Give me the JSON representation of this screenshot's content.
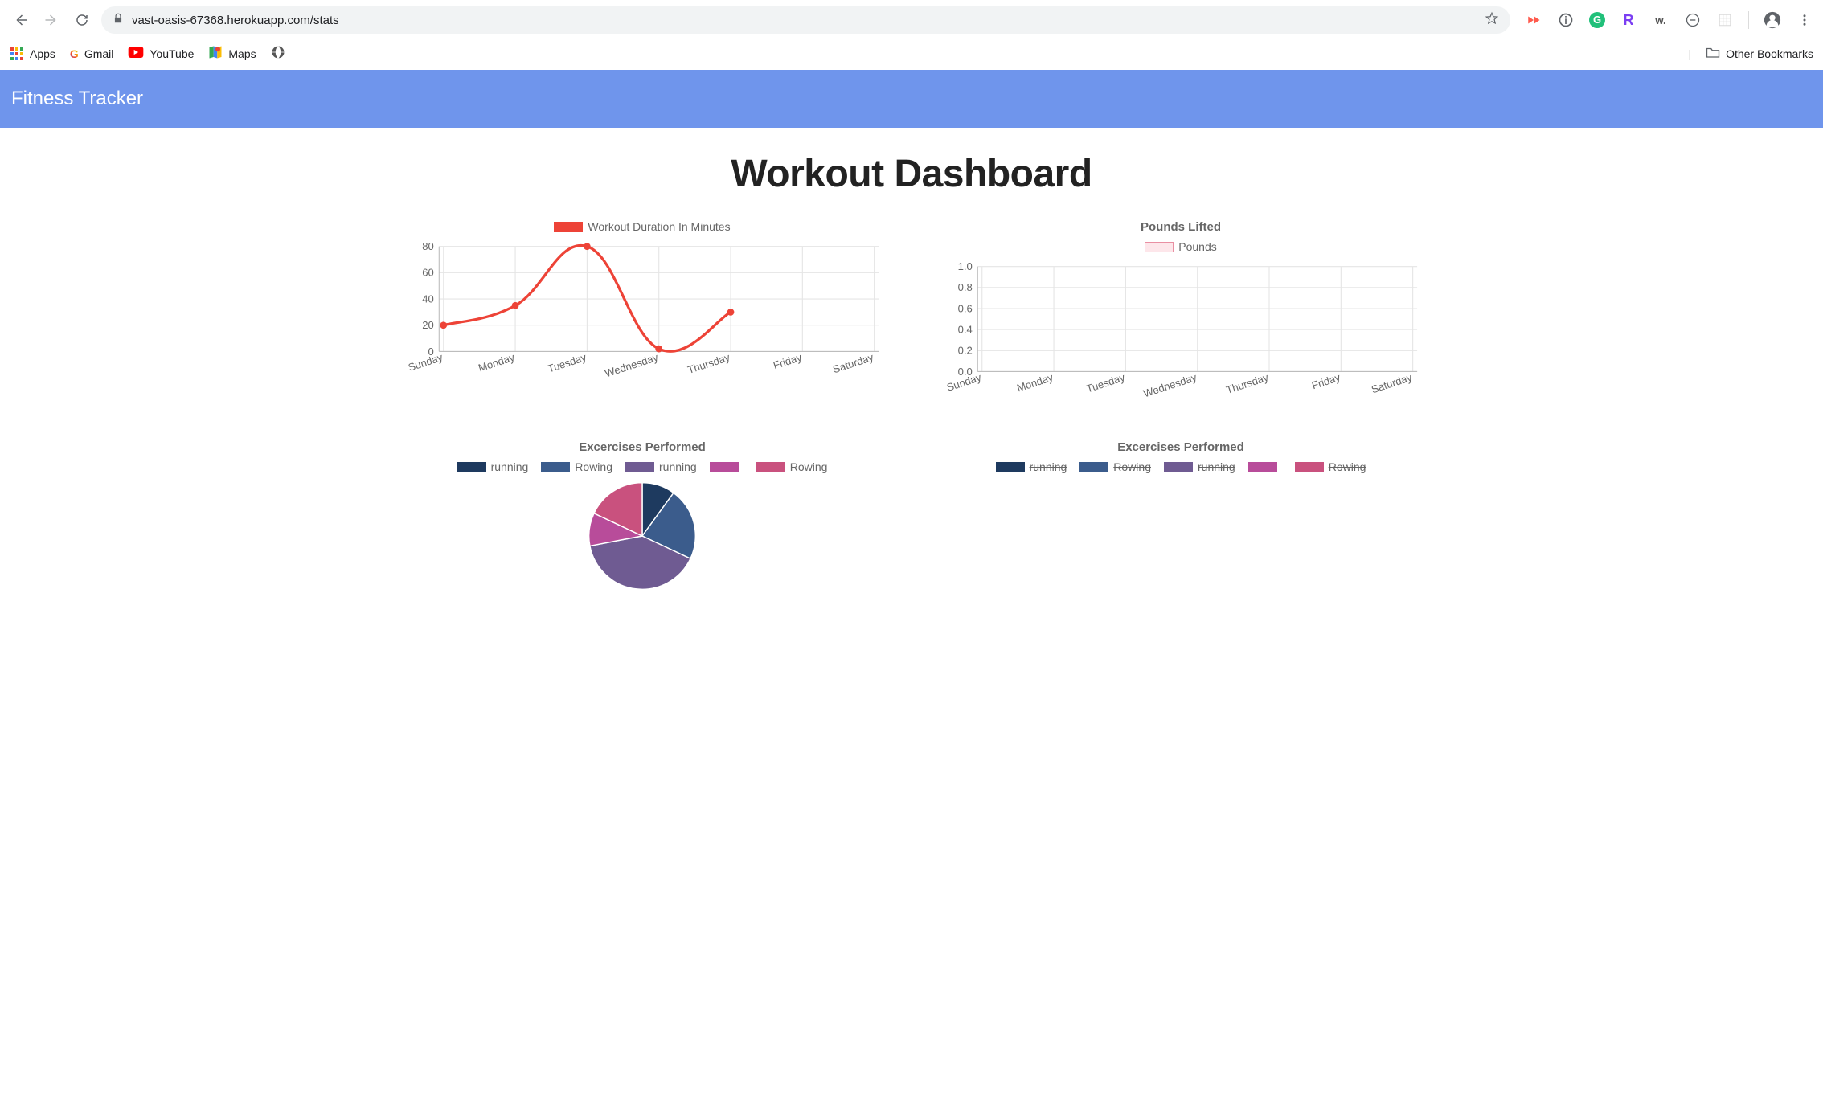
{
  "browser": {
    "url": "vast-oasis-67368.herokuapp.com/stats",
    "bookmarks": {
      "apps": "Apps",
      "gmail": "Gmail",
      "youtube": "YouTube",
      "maps": "Maps",
      "other": "Other Bookmarks"
    }
  },
  "header": {
    "title": "Fitness Tracker"
  },
  "page": {
    "title": "Workout Dashboard"
  },
  "colors": {
    "red": "#ed4337",
    "pinkFill": "#fde6ea",
    "pinkStroke": "#e98fa2",
    "navy": "#1e3a5f",
    "steel": "#3b5c8c",
    "purple": "#6f5b92",
    "magenta": "#b84c9a",
    "rose": "#c9517e"
  },
  "chart_data": [
    {
      "type": "line",
      "title": "",
      "legend": "Workout Duration In Minutes",
      "categories": [
        "Sunday",
        "Monday",
        "Tuesday",
        "Wednesday",
        "Thursday",
        "Friday",
        "Saturday"
      ],
      "values": [
        20,
        35,
        80,
        2,
        30,
        null,
        null
      ],
      "ylim": [
        0,
        80
      ],
      "ystep": 20,
      "color": "#ed4337"
    },
    {
      "type": "bar",
      "title": "Pounds Lifted",
      "legend": "Pounds",
      "categories": [
        "Sunday",
        "Monday",
        "Tuesday",
        "Wednesday",
        "Thursday",
        "Friday",
        "Saturday"
      ],
      "values": [
        null,
        null,
        null,
        null,
        null,
        null,
        null
      ],
      "ylim": [
        0,
        1.0
      ],
      "ystep": 0.2,
      "fill": "#fde6ea",
      "stroke": "#e98fa2"
    },
    {
      "type": "pie",
      "title": "Excercises Performed",
      "legend_items": [
        {
          "name": "running",
          "color": "#1e3a5f"
        },
        {
          "name": "Rowing",
          "color": "#3b5c8c"
        },
        {
          "name": "running",
          "color": "#6f5b92"
        },
        {
          "name": "",
          "color": "#b84c9a"
        },
        {
          "name": "Rowing",
          "color": "#c9517e"
        }
      ],
      "slices": [
        {
          "name": "running",
          "value": 10,
          "color": "#1e3a5f"
        },
        {
          "name": "Rowing",
          "value": 22,
          "color": "#3b5c8c"
        },
        {
          "name": "running",
          "value": 40,
          "color": "#6f5b92"
        },
        {
          "name": "",
          "value": 10,
          "color": "#b84c9a"
        },
        {
          "name": "Rowing",
          "value": 18,
          "color": "#c9517e"
        }
      ]
    },
    {
      "type": "pie",
      "title": "Excercises Performed",
      "legend_items": [
        {
          "name": "running",
          "color": "#1e3a5f",
          "strike": true
        },
        {
          "name": "Rowing",
          "color": "#3b5c8c",
          "strike": true
        },
        {
          "name": "running",
          "color": "#6f5b92",
          "strike": true
        },
        {
          "name": "",
          "color": "#b84c9a"
        },
        {
          "name": "Rowing",
          "color": "#c9517e",
          "strike": true
        }
      ],
      "slices": []
    }
  ]
}
